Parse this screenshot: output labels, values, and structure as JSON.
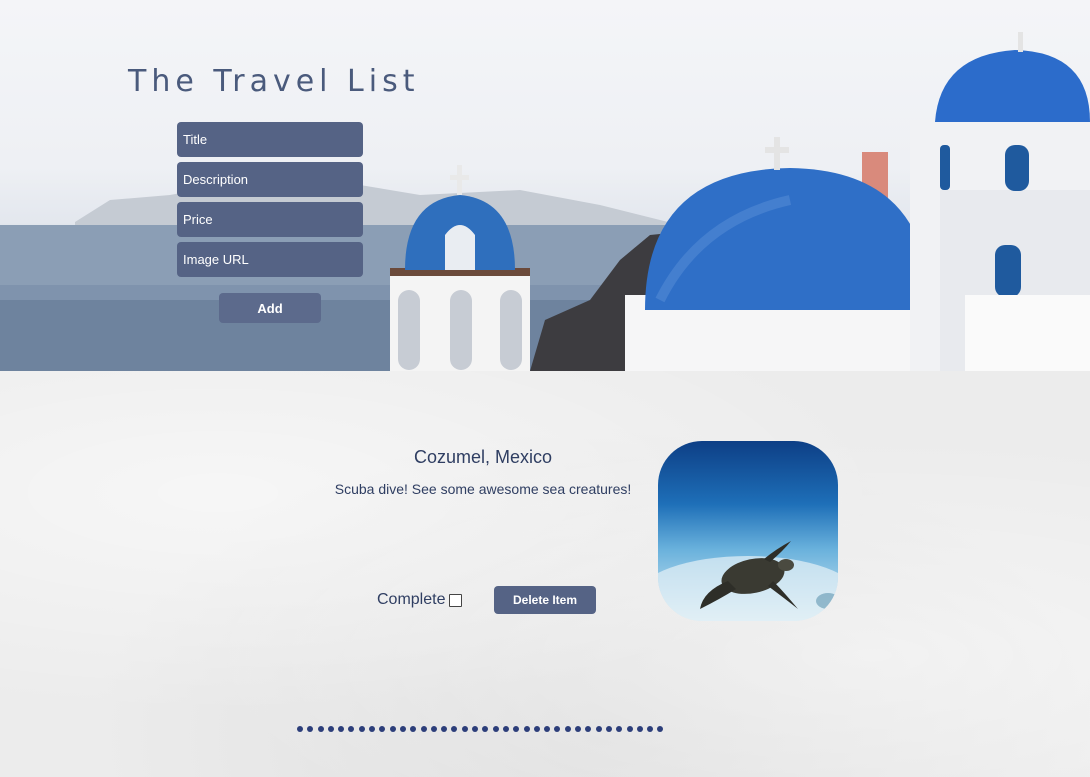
{
  "app": {
    "title": "The Travel List"
  },
  "form": {
    "title_placeholder": "Title",
    "description_placeholder": "Description",
    "price_placeholder": "Price",
    "image_url_placeholder": "Image URL",
    "add_label": "Add"
  },
  "items": [
    {
      "title": "Cozumel, Mexico",
      "description": "Scuba dive! See some awesome sea creatures!",
      "complete_label": "Complete",
      "complete_checked": false,
      "delete_label": "Delete Item"
    }
  ],
  "colors": {
    "primary": "#556385",
    "title_text": "#4a5a7c",
    "body_text": "#2f3e62",
    "divider_dots": "#2c3e7a"
  }
}
